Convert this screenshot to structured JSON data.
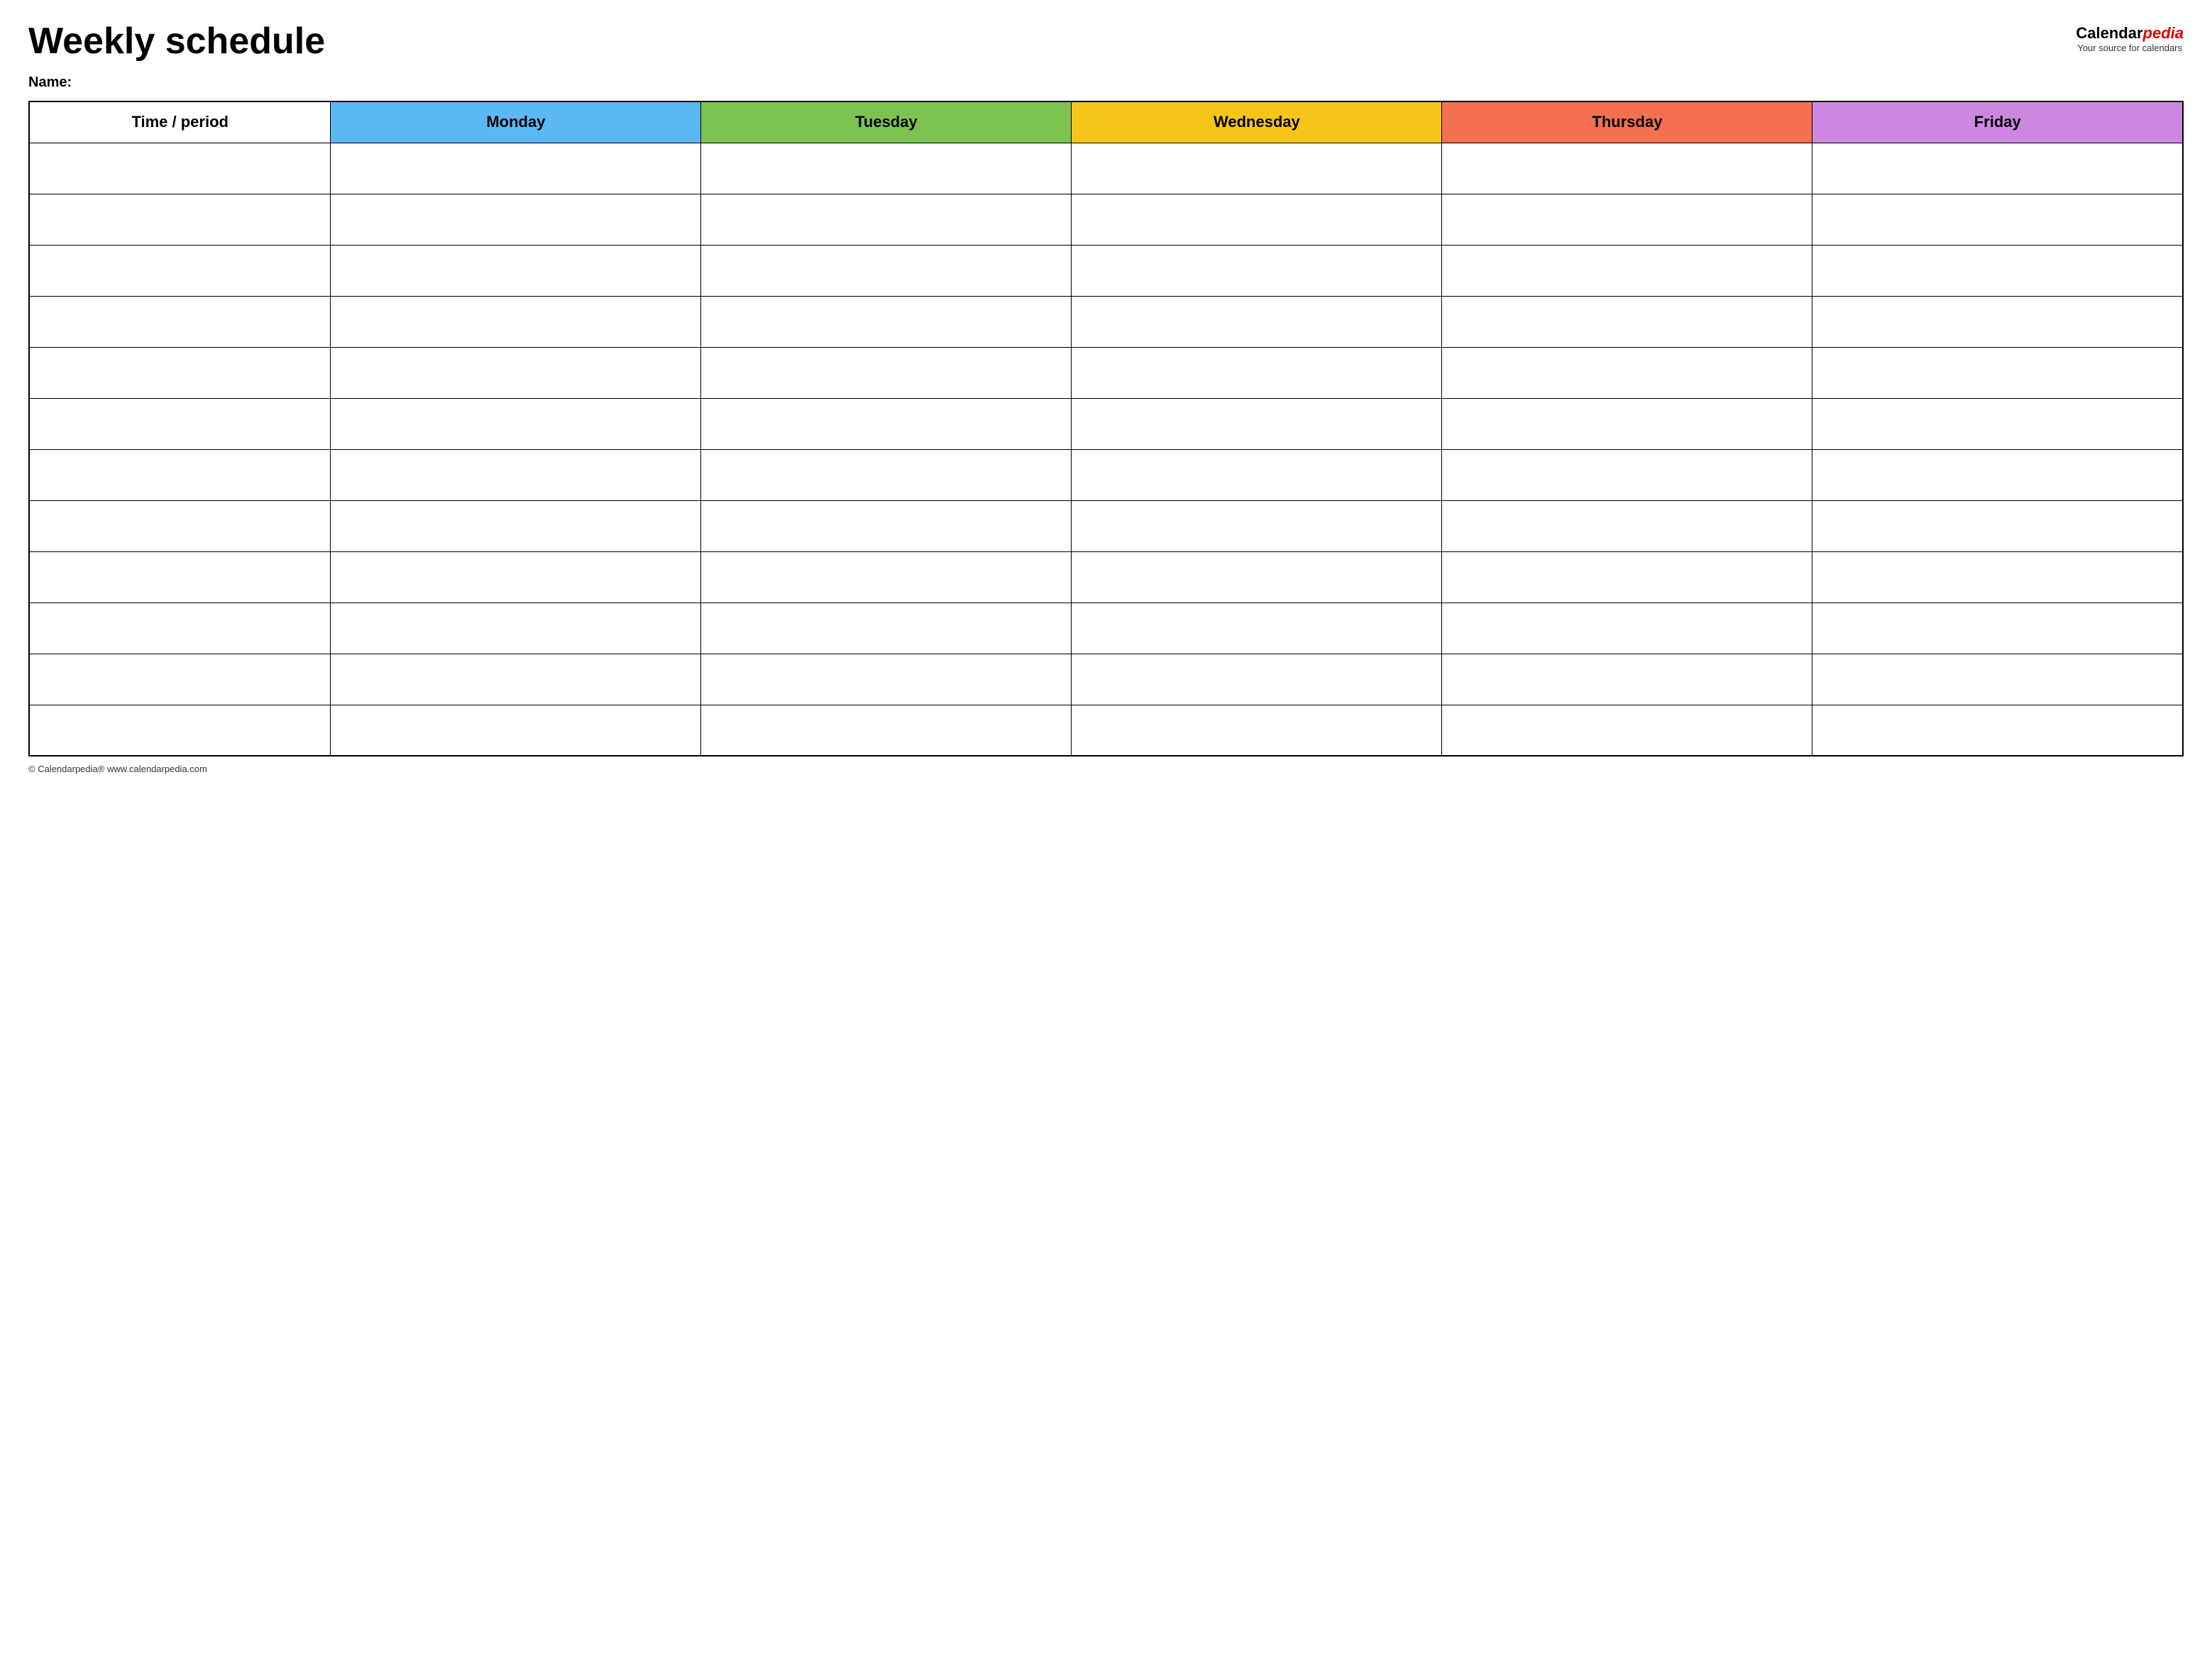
{
  "header": {
    "title": "Weekly schedule",
    "logo_calendar": "Calendar",
    "logo_pedia": "pedia",
    "logo_tagline": "Your source for calendars"
  },
  "name_label": "Name:",
  "table": {
    "columns": [
      {
        "label": "Time / period",
        "class": "col-time"
      },
      {
        "label": "Monday",
        "class": "col-monday"
      },
      {
        "label": "Tuesday",
        "class": "col-tuesday"
      },
      {
        "label": "Wednesday",
        "class": "col-wednesday"
      },
      {
        "label": "Thursday",
        "class": "col-thursday"
      },
      {
        "label": "Friday",
        "class": "col-friday"
      }
    ],
    "row_count": 12
  },
  "footer": {
    "text": "© Calendarpedia®  www.calendarpedia.com"
  }
}
